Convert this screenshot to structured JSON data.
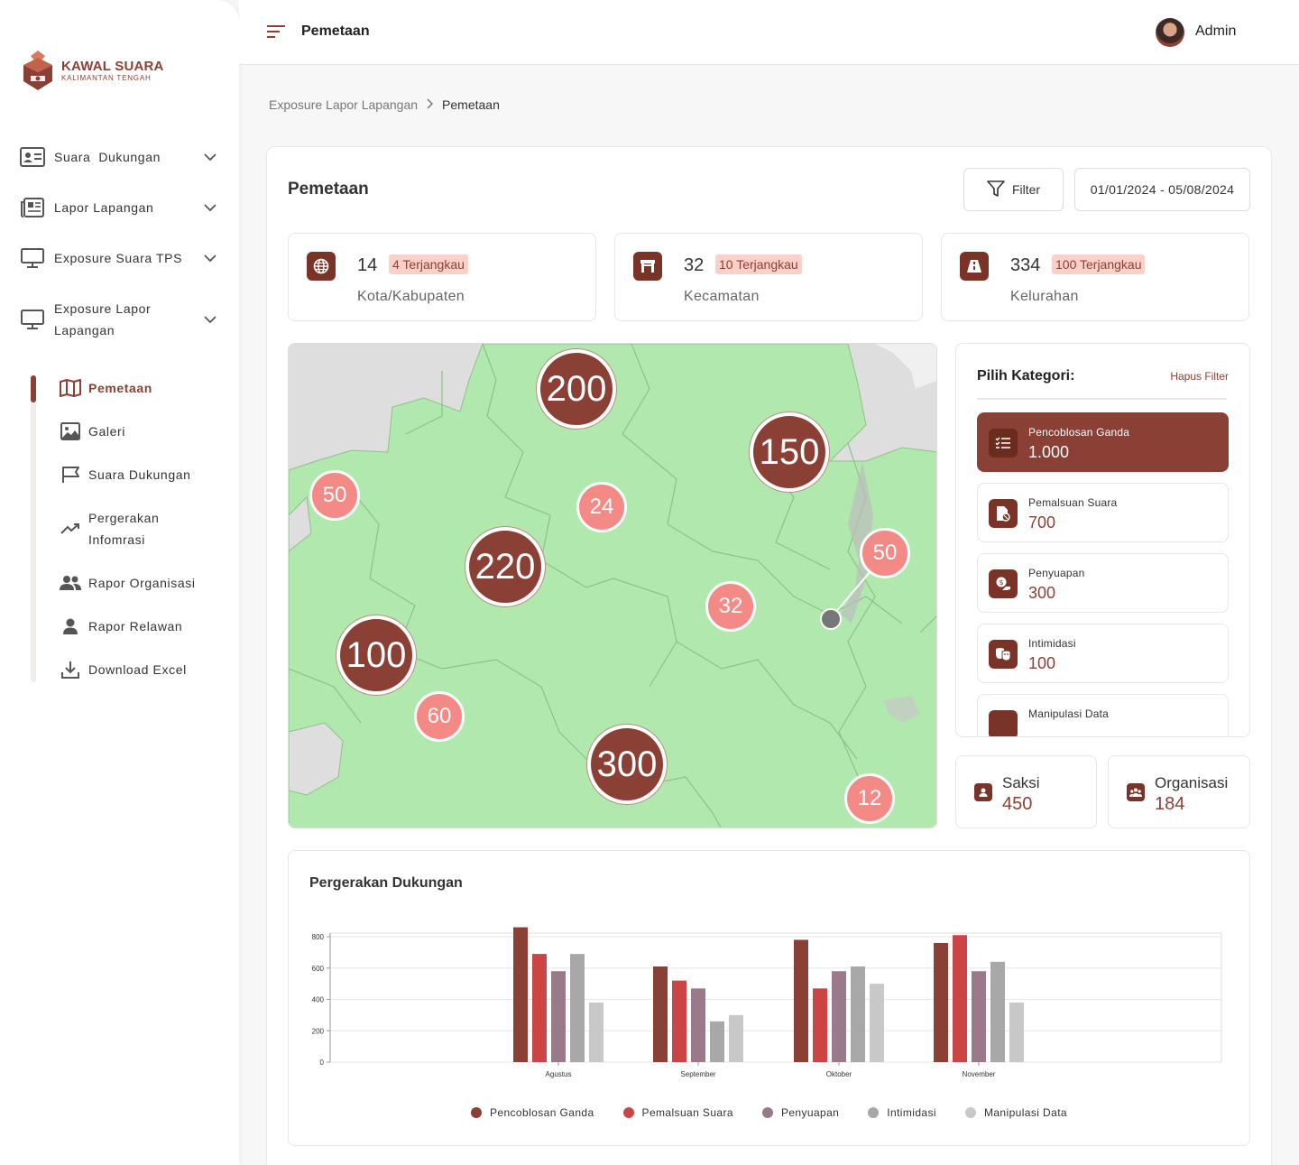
{
  "brand": {
    "title": "KAWAL SUARA",
    "subtitle": "KALIMANTAN TENGAH"
  },
  "sidebar": {
    "items": [
      {
        "label": "Suara  Dukungan",
        "icon": "id-card-icon"
      },
      {
        "label": "Lapor Lapangan",
        "icon": "newspaper-icon"
      },
      {
        "label": "Exposure Suara TPS",
        "icon": "monitor-icon"
      },
      {
        "label": "Exposure Lapor",
        "label2": "Lapangan",
        "icon": "monitor-icon"
      }
    ],
    "subitems": [
      {
        "label": "Pemetaan",
        "icon": "map-icon",
        "active": true
      },
      {
        "label": "Galeri",
        "icon": "image-icon"
      },
      {
        "label": "Suara Dukungan",
        "icon": "flag-icon"
      },
      {
        "label": "Pergerakan",
        "label2": "Infomrasi",
        "icon": "trend-icon"
      },
      {
        "label": "Rapor Organisasi",
        "icon": "users-icon"
      },
      {
        "label": "Rapor Relawan",
        "icon": "user-icon"
      },
      {
        "label": "Download Excel",
        "icon": "download-icon"
      }
    ]
  },
  "topbar": {
    "title": "Pemetaan",
    "user": "Admin"
  },
  "breadcrumb": {
    "parent": "Exposure Lapor Lapangan",
    "current": "Pemetaan"
  },
  "panel": {
    "title": "Pemetaan",
    "filter_label": "Filter",
    "date_range": "01/01/2024 - 05/08/2024"
  },
  "stats": [
    {
      "value": "14",
      "badge": "4 Terjangkau",
      "label": "Kota/Kabupaten",
      "icon": "globe-icon"
    },
    {
      "value": "32",
      "badge": "10 Terjangkau",
      "label": "Kecamatan",
      "icon": "gate-icon"
    },
    {
      "value": "334",
      "badge": "100 Terjangkau",
      "label": "Kelurahan",
      "icon": "road-icon"
    }
  ],
  "map": {
    "clusters_big": [
      "200",
      "150",
      "220",
      "100",
      "300"
    ],
    "clusters_small": [
      "50",
      "24",
      "50",
      "32",
      "60",
      "12"
    ]
  },
  "categories": {
    "title": "Pilih Kategori:",
    "clear_label": "Hapus Filter",
    "items": [
      {
        "name": "Pencoblosan Ganda",
        "value": "1.000",
        "icon": "list-check-icon",
        "active": true
      },
      {
        "name": "Pemalsuan Suara",
        "value": "700",
        "icon": "fake-doc-icon"
      },
      {
        "name": "Penyuapan",
        "value": "300",
        "icon": "bribe-icon"
      },
      {
        "name": "Intimidasi",
        "value": "100",
        "icon": "mask-icon"
      },
      {
        "name": "Manipulasi Data",
        "value": "",
        "icon": "data-icon"
      }
    ]
  },
  "summary": [
    {
      "name": "Saksi",
      "value": "450",
      "icon": "witness-icon"
    },
    {
      "name": "Organisasi",
      "value": "184",
      "icon": "organization-icon"
    }
  ],
  "colors": {
    "primary": "#8a4035",
    "series": [
      "#8a4035",
      "#cc4444",
      "#9a7a8a",
      "#a8a8a8",
      "#c8c8c8"
    ],
    "map_land": "#b0e8ad"
  },
  "chart_data": {
    "type": "bar",
    "title": "Pergerakan Dukungan",
    "categories": [
      "Agustus",
      "September",
      "Oktober",
      "November"
    ],
    "ylim": [
      0,
      800
    ],
    "yticks": [
      0,
      200,
      400,
      600,
      800
    ],
    "legend_position": "bottom",
    "grid": true,
    "series": [
      {
        "name": "Pencoblosan Ganda",
        "values": [
          860,
          610,
          780,
          760
        ]
      },
      {
        "name": "Pemalsuan Suara",
        "values": [
          690,
          520,
          470,
          810
        ]
      },
      {
        "name": "Penyuapan",
        "values": [
          580,
          470,
          580,
          580
        ]
      },
      {
        "name": "Intimidasi",
        "values": [
          690,
          260,
          610,
          640
        ]
      },
      {
        "name": "Manipulasi Data",
        "values": [
          380,
          300,
          500,
          380
        ]
      }
    ]
  }
}
